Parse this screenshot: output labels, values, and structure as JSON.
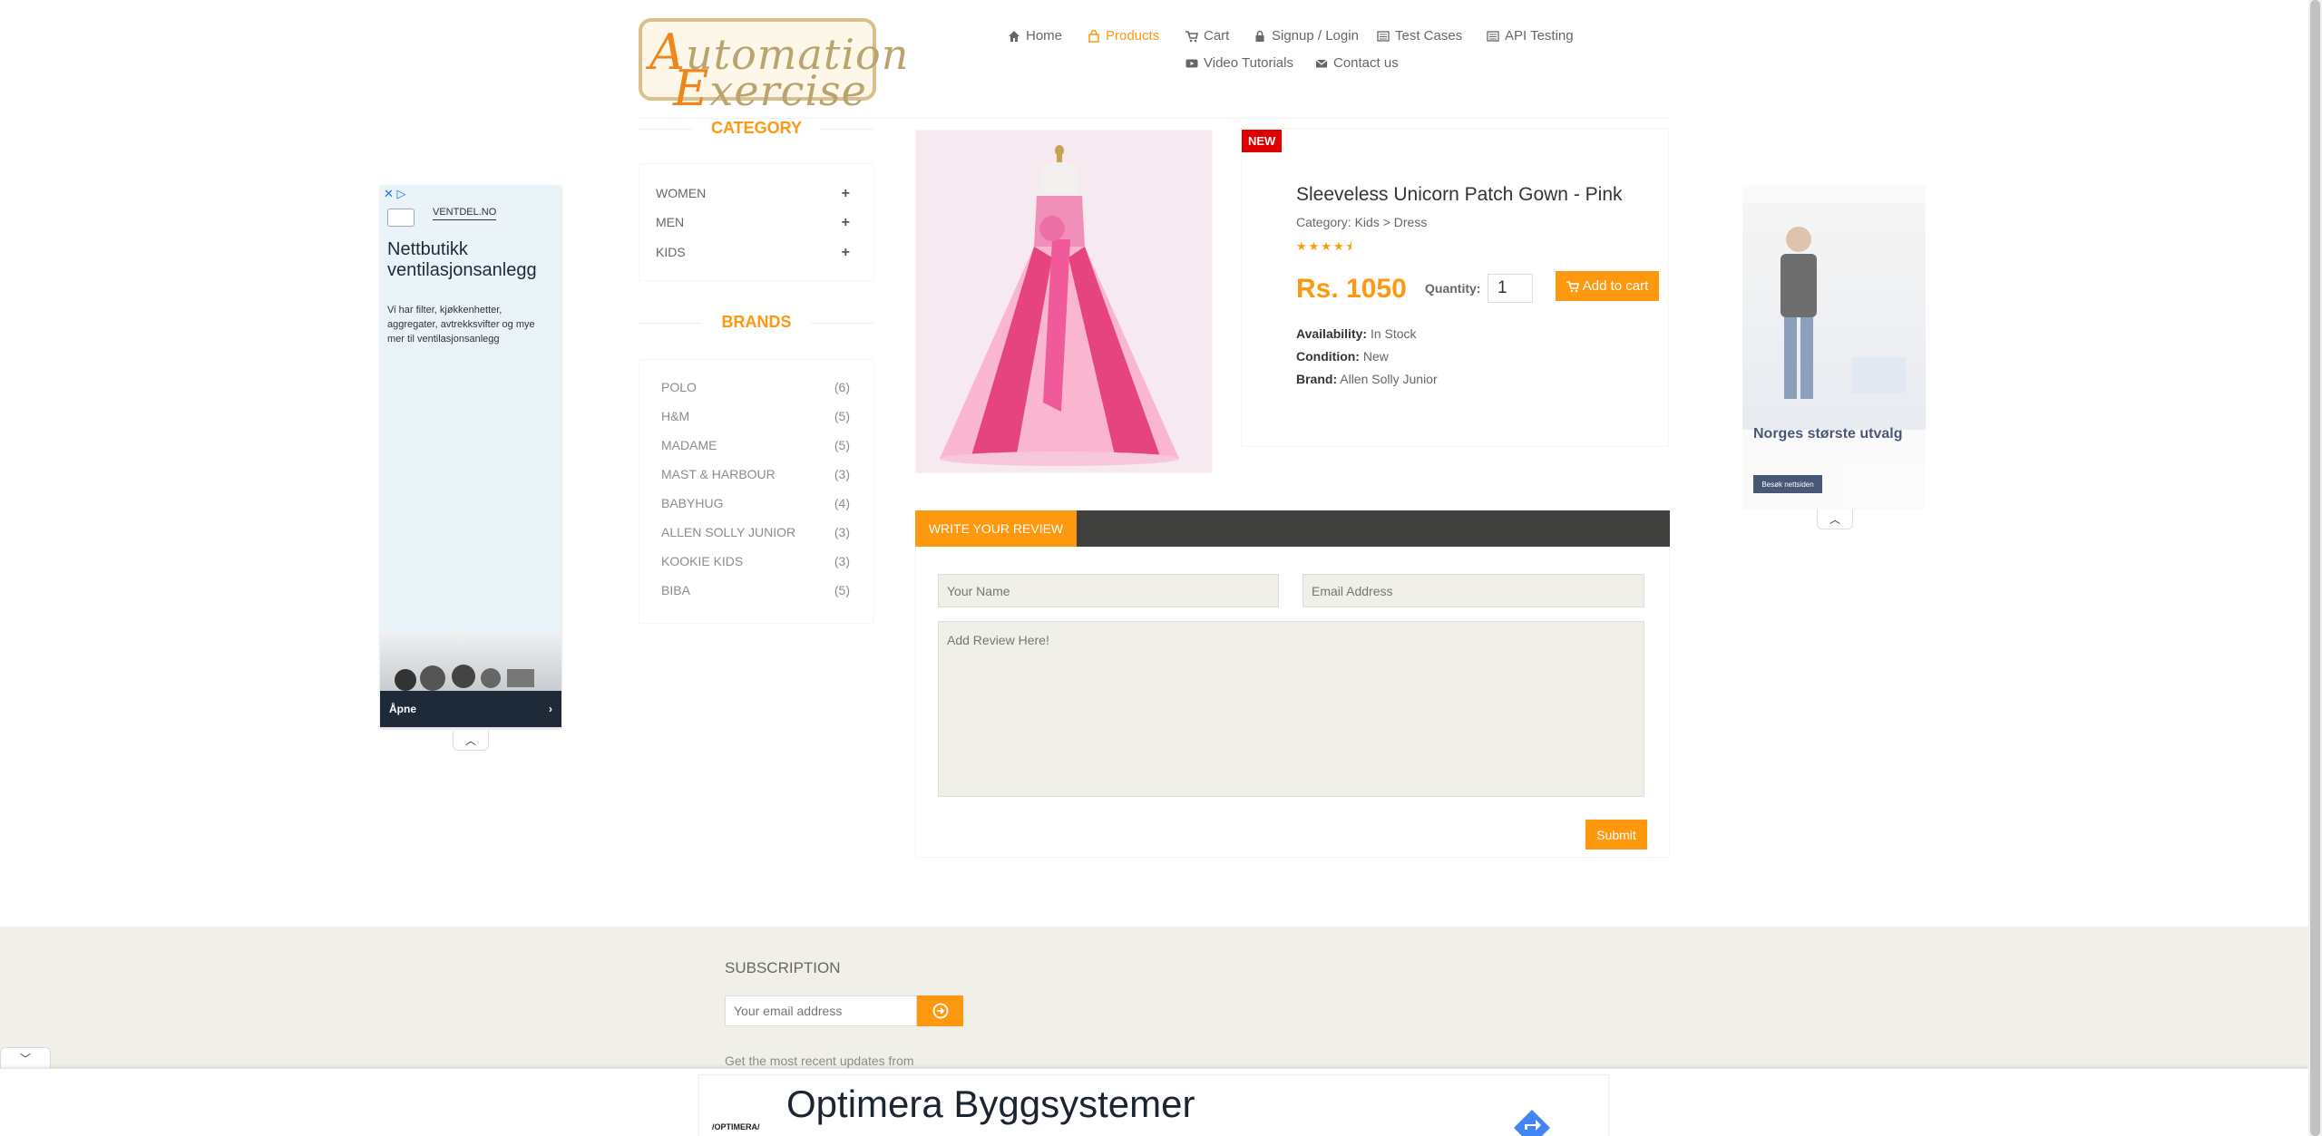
{
  "logo": {
    "line1_first": "A",
    "line1_rest": "utomation",
    "line2_first": "E",
    "line2_rest": "xercise"
  },
  "nav": {
    "home": "Home",
    "products": "Products",
    "cart": "Cart",
    "signup_login": "Signup / Login",
    "test_cases": "Test Cases",
    "api_testing": "API Testing",
    "video_tutorials": "Video Tutorials",
    "contact_us": "Contact us"
  },
  "sidebar": {
    "category_title": "CATEGORY",
    "categories": [
      {
        "label": "WOMEN",
        "toggle": "+"
      },
      {
        "label": "MEN",
        "toggle": "+"
      },
      {
        "label": "KIDS",
        "toggle": "+"
      }
    ],
    "brands_title": "BRANDS",
    "brands": [
      {
        "label": "POLO",
        "count": "(6)"
      },
      {
        "label": "H&M",
        "count": "(5)"
      },
      {
        "label": "MADAME",
        "count": "(5)"
      },
      {
        "label": "MAST & HARBOUR",
        "count": "(3)"
      },
      {
        "label": "BABYHUG",
        "count": "(4)"
      },
      {
        "label": "ALLEN SOLLY JUNIOR",
        "count": "(3)"
      },
      {
        "label": "KOOKIE KIDS",
        "count": "(3)"
      },
      {
        "label": "BIBA",
        "count": "(5)"
      }
    ]
  },
  "product": {
    "badge": "NEW",
    "name": "Sleeveless Unicorn Patch Gown - Pink",
    "category": "Category: Kids > Dress",
    "rating": 4.5,
    "stars": "★★★★⯨",
    "price": "Rs. 1050",
    "quantity_label": "Quantity:",
    "quantity_value": "1",
    "add_to_cart": "Add to cart",
    "availability_label": "Availability:",
    "availability_value": " In Stock",
    "condition_label": "Condition:",
    "condition_value": " New",
    "brand_label": "Brand:",
    "brand_value": " Allen Solly Junior"
  },
  "review": {
    "tab_label": "WRITE YOUR REVIEW",
    "name_placeholder": "Your Name",
    "email_placeholder": "Email Address",
    "review_placeholder": "Add Review Here!",
    "submit": "Submit"
  },
  "ad_left": {
    "domain": "VENTDEL.NO",
    "headline": "Nettbutikk ventilasjonsanlegg",
    "body": "Vi har filter, kjøkkenhetter, aggregater, avtrekksvifter og mye mer til ventilasjonsanlegg",
    "cta": "Åpne"
  },
  "ad_right": {
    "headline": "Norges største utvalg",
    "cta": "Besøk nettsiden"
  },
  "footer": {
    "subscription_title": "SUBSCRIPTION",
    "email_placeholder": "Your email address",
    "description": "Get the most recent updates from"
  },
  "bottom_ad": {
    "headline": "Optimera Byggsystemer",
    "brand": "/OPTIMERA/"
  },
  "colors": {
    "accent": "#fe980f",
    "badge": "#e00000",
    "review_bar": "#40403e",
    "footer_bg": "#f0f0e9"
  }
}
